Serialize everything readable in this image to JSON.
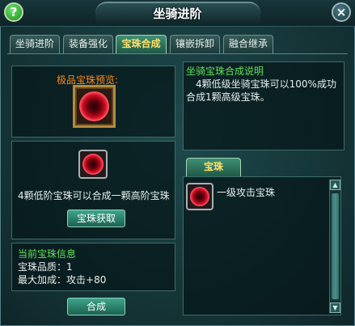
{
  "window": {
    "title": "坐骑进阶"
  },
  "tabs": [
    {
      "label": "坐骑进阶"
    },
    {
      "label": "装备强化"
    },
    {
      "label": "宝珠合成"
    },
    {
      "label": "镶嵌拆卸"
    },
    {
      "label": "融合继承"
    }
  ],
  "active_tab": "宝珠合成",
  "left": {
    "preview_label": "极品宝珠预览:",
    "combine_hint": "4颗低阶宝珠可以合成一颗高阶宝珠",
    "get_gem_button": "宝珠获取"
  },
  "info": {
    "heading": "当前宝珠信息",
    "quality_label": "宝珠品质：",
    "quality_value": "1",
    "bonus_label": "最大加成：",
    "bonus_value": "攻击+80"
  },
  "combine_button": "合成",
  "description": {
    "heading": "坐骑宝珠合成说明",
    "line1": "4颗低级坐骑宝珠可以100%成功",
    "line2": "合成1颗高级宝珠。"
  },
  "gem_list": {
    "tab_label": "宝珠",
    "items": [
      {
        "name": "一级攻击宝珠"
      }
    ]
  },
  "colors": {
    "active_tab_text": "#ffe06a",
    "heading_green": "#62e25a",
    "preview_orange": "#ff8a1a"
  }
}
